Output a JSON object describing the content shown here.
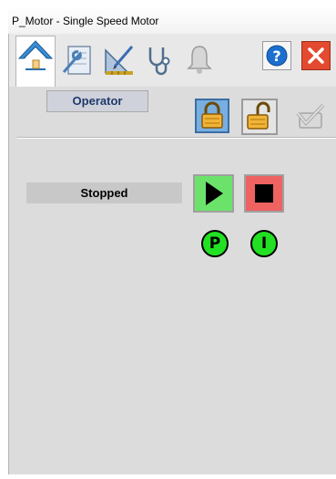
{
  "window": {
    "title": "P_Motor - Single Speed Motor"
  },
  "tabs": [
    {
      "icon": "home-icon",
      "selected": true
    },
    {
      "icon": "maintenance-icon"
    },
    {
      "icon": "engineering-icon"
    },
    {
      "icon": "diagnostics-icon"
    },
    {
      "icon": "alarm-bell-icon"
    }
  ],
  "title_buttons": [
    {
      "icon": "help-icon",
      "text": "?"
    },
    {
      "icon": "close-icon"
    }
  ],
  "operator": {
    "label": "Operator"
  },
  "status": {
    "text": "Stopped"
  },
  "indicators": [
    {
      "text": "P"
    },
    {
      "text": "I"
    }
  ],
  "colors": {
    "active_lock": "#78aee0",
    "start": "#6be36b",
    "stop": "#ef6262",
    "indicator": "#22e122",
    "close": "#e34a2f",
    "help": "#1b6fcf"
  }
}
